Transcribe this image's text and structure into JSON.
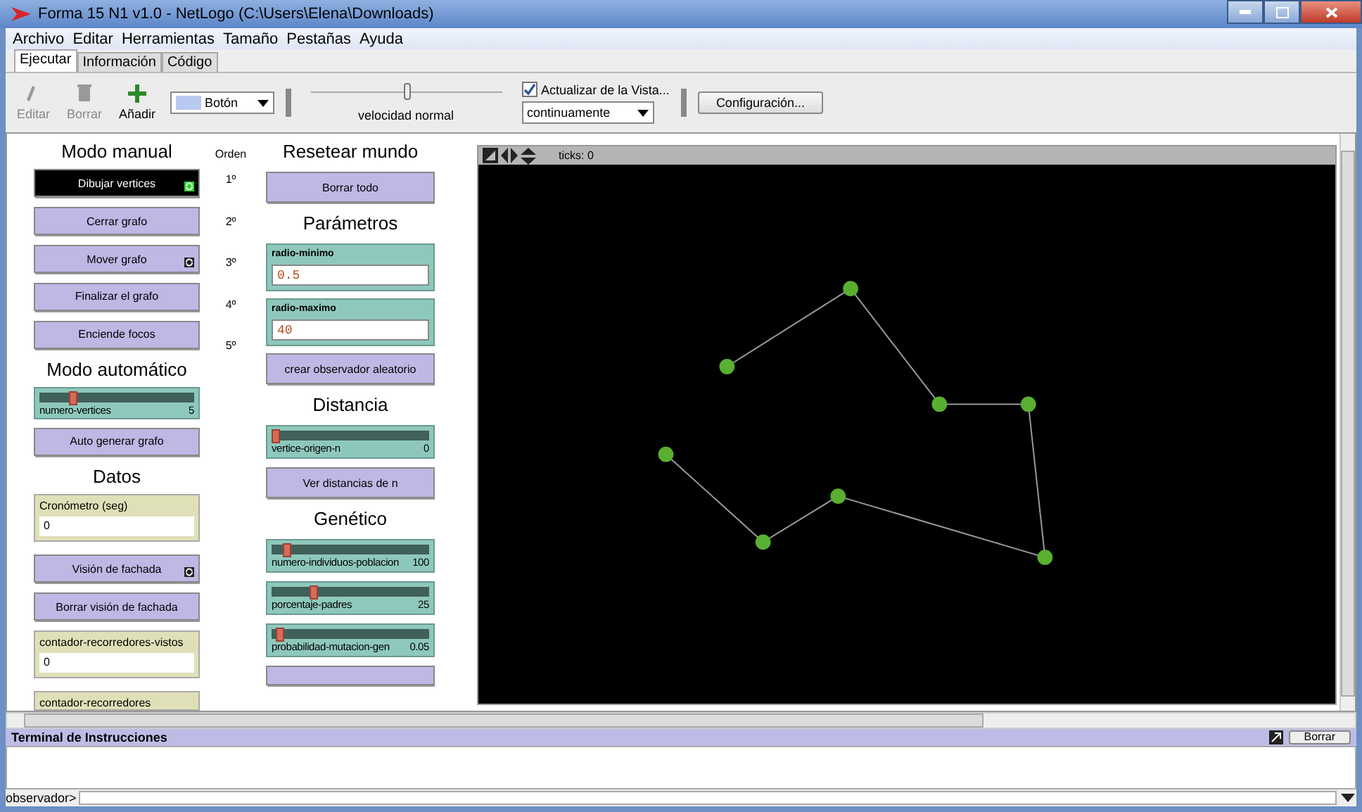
{
  "window": {
    "title": "Forma 15 N1 v1.0 - NetLogo (C:\\Users\\Elena\\Downloads)"
  },
  "menu": [
    "Archivo",
    "Editar",
    "Herramientas",
    "Tamaño",
    "Pestañas",
    "Ayuda"
  ],
  "tabs": [
    {
      "label": "Ejecutar",
      "selected": true
    },
    {
      "label": "Información",
      "selected": false
    },
    {
      "label": "Código",
      "selected": false
    }
  ],
  "toolbar": {
    "tools": [
      {
        "label": "Editar",
        "kind": "edit",
        "disabled": true
      },
      {
        "label": "Borrar",
        "kind": "delete",
        "disabled": true
      },
      {
        "label": "Añadir",
        "kind": "add",
        "disabled": false
      }
    ],
    "widget_type": "Botón",
    "speed": {
      "level": 0.5,
      "label": "velocidad normal"
    },
    "view_updates": {
      "label": "Actualizar de la Vista...",
      "checked": true
    },
    "update_mode": "continuamente",
    "settings_button": "Configuración..."
  },
  "interface": {
    "left": [
      {
        "kind": "title",
        "text": "Modo manual"
      },
      {
        "kind": "button",
        "text": "Dibujar vertices",
        "forever": true,
        "pressed": true
      },
      {
        "kind": "button",
        "text": "Cerrar grafo",
        "forever": false,
        "pressed": false
      },
      {
        "kind": "button",
        "text": "Mover grafo",
        "forever": true,
        "pressed": false
      },
      {
        "kind": "button",
        "text": "Finalizar el grafo",
        "forever": false,
        "pressed": false
      },
      {
        "kind": "button",
        "text": "Enciende focos",
        "forever": false,
        "pressed": false
      },
      {
        "kind": "title",
        "text": "Modo automático"
      },
      {
        "kind": "slider",
        "text": "numero-vertices",
        "value": "5",
        "level": 0.2
      },
      {
        "kind": "button",
        "text": "Auto generar grafo",
        "forever": false,
        "pressed": false
      },
      {
        "kind": "title",
        "text": "Datos"
      },
      {
        "kind": "monitor",
        "text": "Cronómetro (seg)",
        "value": "0"
      },
      {
        "kind": "button",
        "text": "Visión de fachada",
        "forever": true,
        "pressed": false
      },
      {
        "kind": "button",
        "text": "Borrar visión de fachada",
        "forever": false,
        "pressed": false
      },
      {
        "kind": "monitor",
        "text": "contador-recorredores-vistos",
        "value": "0"
      },
      {
        "kind": "monitor",
        "text": "contador-recorredores"
      }
    ],
    "order": {
      "title": "Orden",
      "marks": [
        "1º",
        "2º",
        "3º",
        "4º",
        "5º"
      ]
    },
    "middle": [
      {
        "kind": "title",
        "text": "Resetear mundo"
      },
      {
        "kind": "button",
        "text": "Borrar todo",
        "forever": false,
        "pressed": false
      },
      {
        "kind": "title",
        "text": "Parámetros"
      },
      {
        "kind": "input",
        "text": "radio-minimo",
        "value": "0.5"
      },
      {
        "kind": "input",
        "text": "radio-maximo",
        "value": "40"
      },
      {
        "kind": "button",
        "text": "crear observador aleatorio",
        "forever": false,
        "pressed": false
      },
      {
        "kind": "title",
        "text": "Distancia"
      },
      {
        "kind": "slider",
        "text": "vertice-origen-n",
        "value": "0",
        "level": 0
      },
      {
        "kind": "button",
        "text": "Ver distancias de n",
        "forever": false,
        "pressed": false
      },
      {
        "kind": "title",
        "text": "Genético"
      },
      {
        "kind": "slider",
        "text": "numero-individuos-poblacion",
        "value": "100",
        "level": 0.08
      },
      {
        "kind": "slider",
        "text": "porcentaje-padres",
        "value": "25",
        "level": 0.25
      },
      {
        "kind": "slider",
        "text": "probabilidad-mutacion-gen",
        "value": "0.05",
        "level": 0.03
      },
      {
        "kind": "button",
        "forever": false,
        "pressed": false
      }
    ],
    "view": {
      "ticks": "ticks: 0"
    }
  },
  "terminal": {
    "title": "Terminal de Instrucciones",
    "clear_button": "Borrar",
    "prompt": "observador>"
  }
}
